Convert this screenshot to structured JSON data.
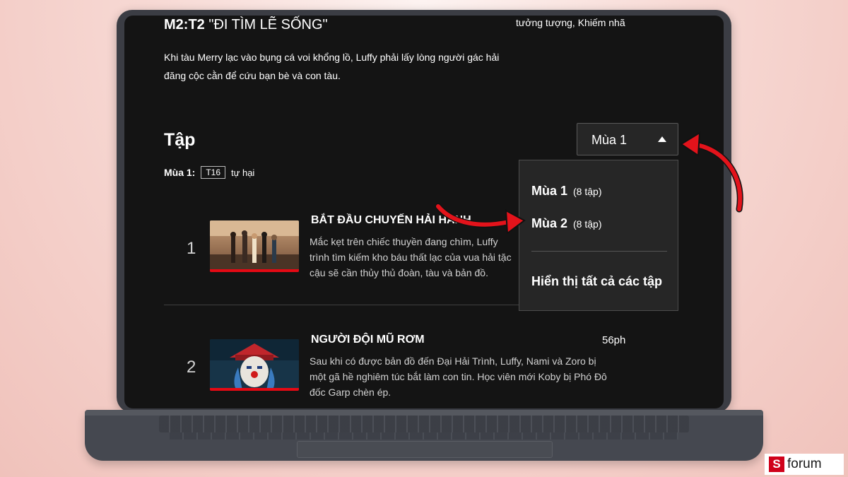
{
  "episode": {
    "code": "M2:T2",
    "title": "\"ĐI TÌM LẼ SỐNG\"",
    "description": "Khi tàu Merry lạc vào bụng cá voi khổng lồ, Luffy phải lấy lòng người gác hải đăng cộc cằn để cứu bạn bè và con tàu.",
    "cast_fragment": "tưởng tượng, Khiếm nhã"
  },
  "episodes_section": {
    "title": "Tập",
    "season_label": "Mùa 1:",
    "rating_badge": "T16",
    "rating_desc": "tự hại"
  },
  "season_selector": {
    "current": "Mùa 1",
    "options": [
      {
        "label": "Mùa 1",
        "count": "(8 tập)"
      },
      {
        "label": "Mùa 2",
        "count": "(8 tập)"
      }
    ],
    "show_all": "Hiển thị tất cả các tập"
  },
  "episode_list": [
    {
      "number": "1",
      "title": "BẮT ĐẦU CHUYẾN HẢI HÀNH",
      "duration": "",
      "lines": [
        "Mắc kẹt trên chiếc thuyền đang chìm, Luffy",
        "trình tìm kiếm kho báu thất lạc của vua hải tặc",
        "cậu sẽ cần thủy thủ đoàn, tàu và bản đồ."
      ]
    },
    {
      "number": "2",
      "title": "NGƯỜI ĐỘI MŨ RƠM",
      "duration": "56ph",
      "lines": [
        "Sau khi có được bản đồ đến Đại Hải Trình, Luffy, Nami và Zoro bị",
        "một gã hề nghiêm túc bắt làm con tin. Học viên mới Koby bị Phó Đô",
        "đốc Garp chèn ép."
      ]
    }
  ],
  "brand": {
    "logo_letter": "S",
    "logo_text": "forum",
    "accent": "#d0021b",
    "progress_color": "#e50914"
  }
}
